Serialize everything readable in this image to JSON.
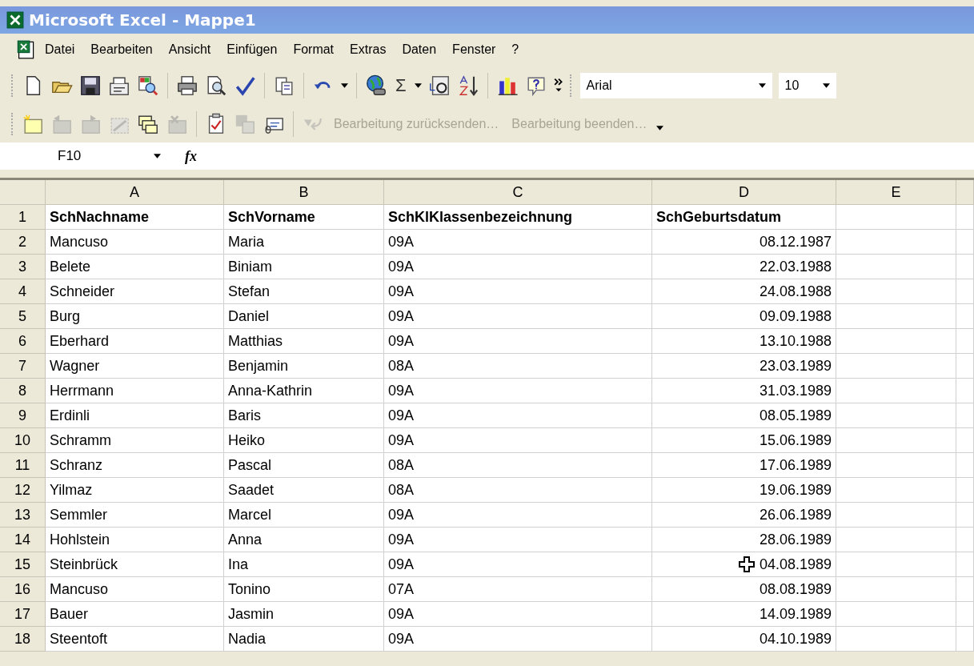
{
  "window": {
    "title": "Microsoft Excel - Mappe1"
  },
  "menu": [
    "Datei",
    "Bearbeiten",
    "Ansicht",
    "Einfügen",
    "Format",
    "Extras",
    "Daten",
    "Fenster",
    "?"
  ],
  "toolbar": {
    "sum_symbol": "Σ",
    "font": "Arial",
    "font_size": "10"
  },
  "review_toolbar": [
    {
      "label": "Bearbeitung zurücksenden…",
      "disabled": true
    },
    {
      "label": "Bearbeitung beenden…",
      "disabled": true
    }
  ],
  "formula_bar": {
    "name_box": "F10",
    "function_label": "fx"
  },
  "sheet": {
    "columns": [
      "A",
      "B",
      "C",
      "D",
      "E"
    ],
    "rows": [
      {
        "number": "1",
        "kind": "header",
        "cursor": false,
        "cells": [
          "SchNachname",
          "SchVorname",
          "SchKlKlassenbezeichnung",
          "SchGeburtsdatum"
        ]
      },
      {
        "number": "2",
        "kind": "data",
        "cursor": false,
        "cells": [
          "Mancuso",
          "Maria",
          "09A",
          "08.12.1987"
        ]
      },
      {
        "number": "3",
        "kind": "data",
        "cursor": false,
        "cells": [
          "Belete",
          "Biniam",
          "09A",
          "22.03.1988"
        ]
      },
      {
        "number": "4",
        "kind": "data",
        "cursor": false,
        "cells": [
          "Schneider",
          "Stefan",
          "09A",
          "24.08.1988"
        ]
      },
      {
        "number": "5",
        "kind": "data",
        "cursor": false,
        "cells": [
          "Burg",
          "Daniel",
          "09A",
          "09.09.1988"
        ]
      },
      {
        "number": "6",
        "kind": "data",
        "cursor": false,
        "cells": [
          "Eberhard",
          "Matthias",
          "09A",
          "13.10.1988"
        ]
      },
      {
        "number": "7",
        "kind": "data",
        "cursor": false,
        "cells": [
          "Wagner",
          "Benjamin",
          "08A",
          "23.03.1989"
        ]
      },
      {
        "number": "8",
        "kind": "data",
        "cursor": false,
        "cells": [
          "Herrmann",
          "Anna-Kathrin",
          "09A",
          "31.03.1989"
        ]
      },
      {
        "number": "9",
        "kind": "data",
        "cursor": false,
        "cells": [
          "Erdinli",
          "Baris",
          "09A",
          "08.05.1989"
        ]
      },
      {
        "number": "10",
        "kind": "data",
        "cursor": false,
        "cells": [
          "Schramm",
          "Heiko",
          "09A",
          "15.06.1989"
        ]
      },
      {
        "number": "11",
        "kind": "data",
        "cursor": false,
        "cells": [
          "Schranz",
          "Pascal",
          "08A",
          "17.06.1989"
        ]
      },
      {
        "number": "12",
        "kind": "data",
        "cursor": false,
        "cells": [
          "Yilmaz",
          "Saadet",
          "08A",
          "19.06.1989"
        ]
      },
      {
        "number": "13",
        "kind": "data",
        "cursor": false,
        "cells": [
          "Semmler",
          "Marcel",
          "09A",
          "26.06.1989"
        ]
      },
      {
        "number": "14",
        "kind": "data",
        "cursor": false,
        "cells": [
          "Hohlstein",
          "Anna",
          "09A",
          "28.06.1989"
        ]
      },
      {
        "number": "15",
        "kind": "data",
        "cursor": true,
        "cells": [
          "Steinbrück",
          "Ina",
          "09A",
          "04.08.1989"
        ]
      },
      {
        "number": "16",
        "kind": "data",
        "cursor": false,
        "cells": [
          "Mancuso",
          "Tonino",
          "07A",
          "08.08.1989"
        ]
      },
      {
        "number": "17",
        "kind": "data",
        "cursor": false,
        "cells": [
          "Bauer",
          "Jasmin",
          "09A",
          "14.09.1989"
        ]
      },
      {
        "number": "18",
        "kind": "data",
        "cursor": false,
        "cells": [
          "Steentoft",
          "Nadia",
          "09A",
          "04.10.1989"
        ]
      }
    ]
  }
}
